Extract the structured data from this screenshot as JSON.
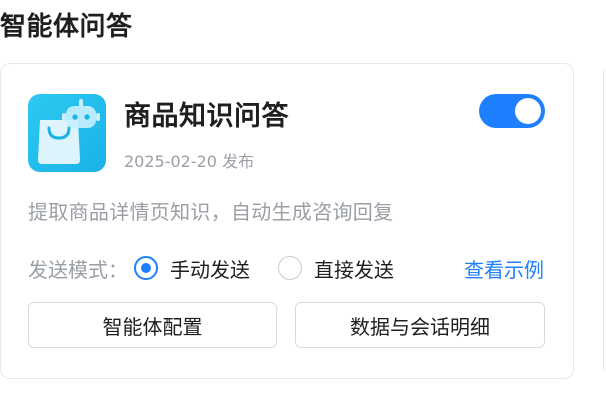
{
  "section": {
    "title": "智能体问答"
  },
  "card": {
    "icon": "shopping-bag-robot-icon",
    "title": "商品知识问答",
    "date": "2025-02-20 发布",
    "enabled": true,
    "description": "提取商品详情页知识，自动生成咨询回复",
    "send_mode": {
      "label": "发送模式：",
      "options": [
        "手动发送",
        "直接发送"
      ],
      "selected": "手动发送"
    },
    "example_link": "查看示例",
    "buttons": {
      "config": "智能体配置",
      "details": "数据与会话明细"
    }
  },
  "colors": {
    "accent": "#1e80ff",
    "icon_bg": "#18b2e8",
    "muted_text": "#9a9ea6"
  }
}
